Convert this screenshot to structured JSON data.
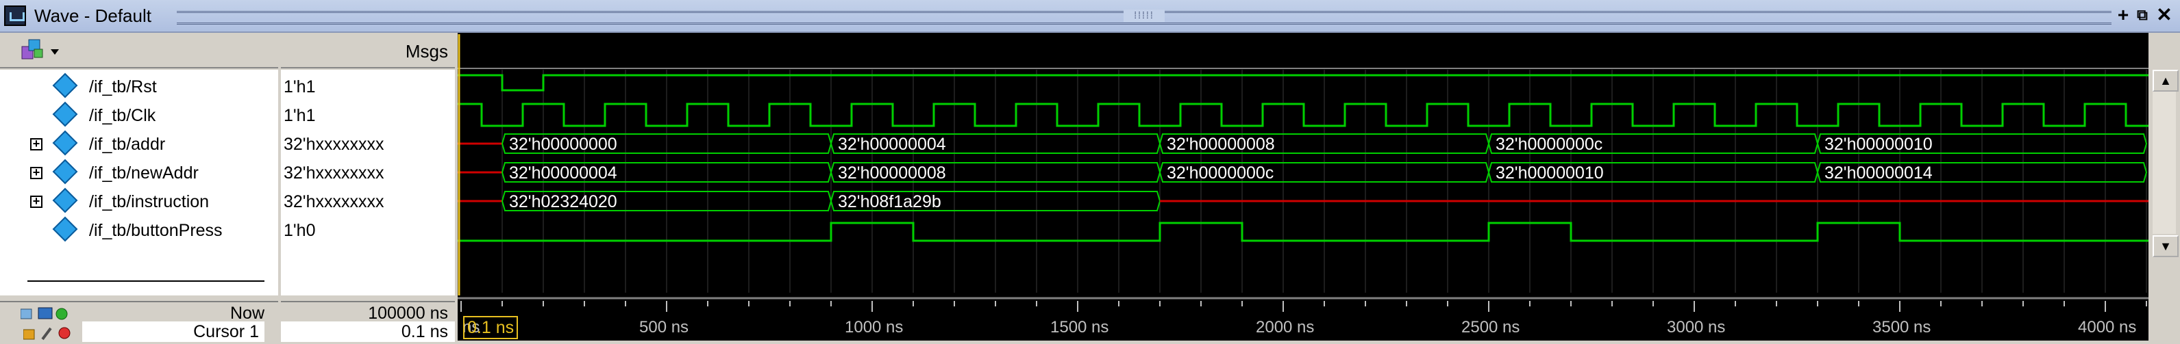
{
  "window": {
    "title": "Wave - Default"
  },
  "columns": {
    "msgs": "Msgs"
  },
  "signals": [
    {
      "name": "/if_tb/Rst",
      "value": "1'h1",
      "expandable": false
    },
    {
      "name": "/if_tb/Clk",
      "value": "1'h1",
      "expandable": false
    },
    {
      "name": "/if_tb/addr",
      "value": "32'hxxxxxxxx",
      "expandable": true
    },
    {
      "name": "/if_tb/newAddr",
      "value": "32'hxxxxxxxx",
      "expandable": true
    },
    {
      "name": "/if_tb/instruction",
      "value": "32'hxxxxxxxx",
      "expandable": true
    },
    {
      "name": "/if_tb/buttonPress",
      "value": "1'h0",
      "expandable": false
    }
  ],
  "bus_labels": {
    "addr": [
      "32'h00000000",
      "32'h00000004",
      "32'h00000008",
      "32'h0000000c",
      "32'h00000010"
    ],
    "newAddr": [
      "32'h00000004",
      "32'h00000008",
      "32'h0000000c",
      "32'h00000010",
      "32'h00000014"
    ],
    "instruction": [
      "32'h02324020",
      "32'h08f1a29b"
    ]
  },
  "footer": {
    "now_label": "Now",
    "now_value": "100000 ns",
    "cursor_label": "Cursor 1",
    "cursor_value": "0.1 ns",
    "cursor_readout": "0.1 ns"
  },
  "timeline": {
    "ticks": [
      "ns",
      "500 ns",
      "1000 ns",
      "1500 ns",
      "2000 ns",
      "2500 ns",
      "3000 ns",
      "3500 ns",
      "4000 ns"
    ]
  },
  "colors": {
    "wave": "#00d000",
    "unknown": "#d00000",
    "cursor": "#e8c020"
  },
  "icons": [
    "wave-window-icon",
    "add-icon",
    "undock-icon",
    "close-icon",
    "group-icon",
    "diamond-icon",
    "expand-icon",
    "scroll-up-icon",
    "scroll-down-icon",
    "lock-icon",
    "edit-icon",
    "remove-icon"
  ]
}
